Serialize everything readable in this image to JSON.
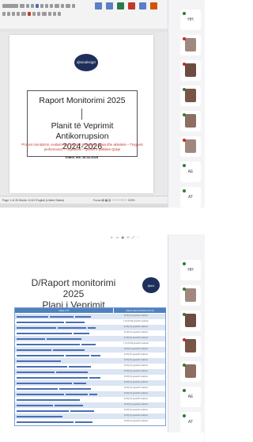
{
  "top_window": {
    "document": {
      "logo_text": "dpsiadesign",
      "title_line1": "Raport Monitorimi 2025",
      "title_line2": "Planit të Veprimit Antikorrupsion",
      "title_line3": "2024-2026",
      "subtitle": "Procesi monitorimi, evaluimi dhe kurrimit të raportit: Masa dhe aktivitete – Treguesi performance – Objektivat – Qëllimi e politikës Qasje",
      "date": "Tiranë, më, 26.02.2025"
    },
    "status_left": "Page 1 of 26   Words: 6,012   English (United States)",
    "status_right": "Focus   ▤   ▦   ▥   ─────+── 100%"
  },
  "bottom_window": {
    "toolbar_glyphs": "⇤ ▭ ▣ ⟲ ⤢ ⋯",
    "slide": {
      "title_line1": "D/Raport monitorimi 2025",
      "title_line2": "Plani i Veprimit",
      "logo_text": "dpsia",
      "table": {
        "headers": [
          "Masat e PV",
          "Statusi sipas monitorimit (në %)"
        ],
        "rows": [
          {
            "status": "[0-25] (%) pjesërisht realizuar"
          },
          {
            "status": "1 (%) [0-25] pjesërisht realizuar"
          },
          {
            "status": "[0-25] (%) pjesërisht realizuar"
          },
          {
            "status": "[0-25] (%) pjesërisht realizuar"
          },
          {
            "status": "[0-25] (%) pjesërisht realizuar"
          },
          {
            "status": "1 (%) [0-50] pjesërisht realizuar"
          },
          {
            "status": "[0-50] (%) pjesërisht realizuar"
          },
          {
            "status": "[0-50] (%) pjesërisht realizuar"
          },
          {
            "status": "[0-50] (%) pjesërisht realizuar"
          },
          {
            "status": "[0-50] (%) pjesërisht realizuar"
          },
          {
            "status": "[0-50] (%) pjesërisht realizuar"
          },
          {
            "status": "[0-50] (%) pjesërisht realizuar"
          },
          {
            "status": "[0-50] (%) pjesërisht realizuar"
          },
          {
            "status": "[0-50] (%) pjesërisht realizuar"
          },
          {
            "status": "[0-50] (%) pjesërisht realizuar"
          },
          {
            "status": "[0-50] (%) pjesërisht realizuar"
          },
          {
            "status": "[0-50] (%) pjesërisht realizuar"
          },
          {
            "status": "[0-50] (%) pjesërisht realizuar"
          },
          {
            "status": "[0-50] (%) pjesërisht realizuar"
          },
          {
            "status": "[0-50] (%) pjesërisht realizuar"
          }
        ]
      }
    }
  },
  "participants_top": [
    {
      "initials": "HH",
      "accent": "#2e7d32"
    },
    {
      "initials": "",
      "accent": "#c62828"
    },
    {
      "initials": "",
      "accent": "#c62828"
    },
    {
      "initials": "",
      "accent": "#2e7d32"
    },
    {
      "initials": "",
      "accent": "#2e7d32"
    },
    {
      "initials": "",
      "accent": "#c62828"
    },
    {
      "initials": "AE",
      "accent": "#2e7d32"
    },
    {
      "initials": "AT",
      "accent": "#2e7d32"
    }
  ],
  "participants_bottom": [
    {
      "initials": "HH",
      "accent": "#2e7d32"
    },
    {
      "initials": "",
      "accent": "#2e7d32"
    },
    {
      "initials": "",
      "accent": "#2e7d32"
    },
    {
      "initials": "",
      "accent": "#c62828"
    },
    {
      "initials": "",
      "accent": "#2e7d32"
    },
    {
      "initials": "AE",
      "accent": "#2e7d32"
    },
    {
      "initials": "AT",
      "accent": "#2e7d32"
    }
  ]
}
